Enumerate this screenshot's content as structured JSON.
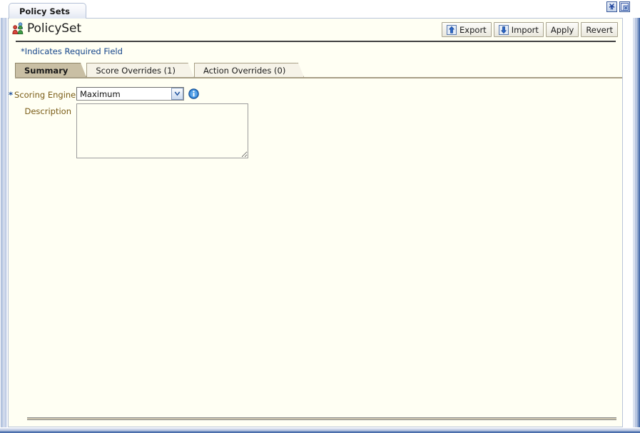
{
  "window": {
    "controls": [
      {
        "name": "close-icon",
        "label": "Close"
      },
      {
        "name": "restore-icon",
        "label": "Restore"
      }
    ]
  },
  "document_tab": {
    "label": "Policy Sets"
  },
  "page": {
    "title": "PolicySet",
    "title_icon": "policyset-users-icon",
    "required_note": "*Indicates Required Field"
  },
  "toolbar": {
    "buttons": [
      {
        "label": "Export",
        "icon": "export-up-arrow-icon",
        "has_icon": true
      },
      {
        "label": "Import",
        "icon": "import-down-arrow-icon",
        "has_icon": true
      },
      {
        "label": "Apply",
        "icon": "",
        "has_icon": false
      },
      {
        "label": "Revert",
        "icon": "",
        "has_icon": false
      }
    ]
  },
  "tabs": [
    {
      "label": "Summary",
      "active": true
    },
    {
      "label": "Score Overrides (1)",
      "active": false
    },
    {
      "label": "Action Overrides (0)",
      "active": false
    }
  ],
  "form": {
    "scoring_engine": {
      "label": "Scoring Engine",
      "required_marker": "*",
      "value": "Maximum",
      "info_icon": "info-circle-icon",
      "dropdown_icon": "chevron-down-icon"
    },
    "description": {
      "label": "Description",
      "value": "",
      "placeholder": ""
    }
  },
  "colors": {
    "panel_background": "#fffff3",
    "active_tab": "#c9bfa4",
    "inactive_tab": "#f6f3e8",
    "label_text": "#7a5c16",
    "link_blue": "#15458a",
    "frame_blue": "#4d70ad"
  }
}
